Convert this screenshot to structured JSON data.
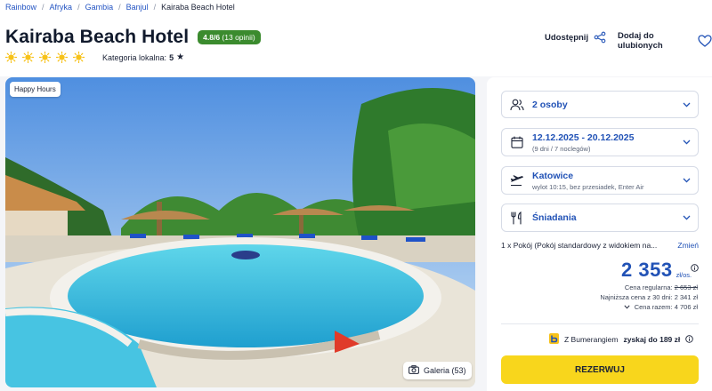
{
  "breadcrumb": [
    "Rainbow",
    "Afryka",
    "Gambia",
    "Banjul",
    "Kairaba Beach Hotel"
  ],
  "hotel": {
    "title": "Kairaba Beach Hotel",
    "rating": "4.8/6",
    "reviews": "(13 opinii)",
    "stars": 5,
    "category_label": "Kategoria lokalna:",
    "category_value": "5"
  },
  "actions": {
    "share": "Udostępnij",
    "favorite": "Dodaj do ulubionych"
  },
  "photo": {
    "badge": "Happy Hours",
    "gallery": "Galeria (53)"
  },
  "booking": {
    "persons": "2 osoby",
    "dates": "12.12.2025 - 20.12.2025",
    "dates_sub": "(9 dni / 7 noclegów)",
    "departure": "Katowice",
    "departure_sub": "wylot 10:15, bez przesiadek, Enter Air",
    "board": "Śniadania",
    "room": "1 x Pokój  (Pokój standardowy z widokiem na...",
    "room_change": "Zmień",
    "price": "2 353",
    "price_unit": "zł/os.",
    "regular_label": "Cena regularna:",
    "regular_value": "2 653 zł",
    "lowest_label": "Najniższa cena z 30 dni:",
    "lowest_value": "2 341 zł",
    "total_label": "Cena razem:",
    "total_value": "4 706 zł",
    "bumerang_pre": "Z Bumerangiem",
    "bumerang_value": "zyskaj do 189 zł",
    "book_button": "REZERWUJ"
  },
  "colors": {
    "accent": "#2152b6",
    "rating_green": "#3b8b2e",
    "book_yellow": "#f8d61c",
    "sun": "#f7c21a"
  }
}
